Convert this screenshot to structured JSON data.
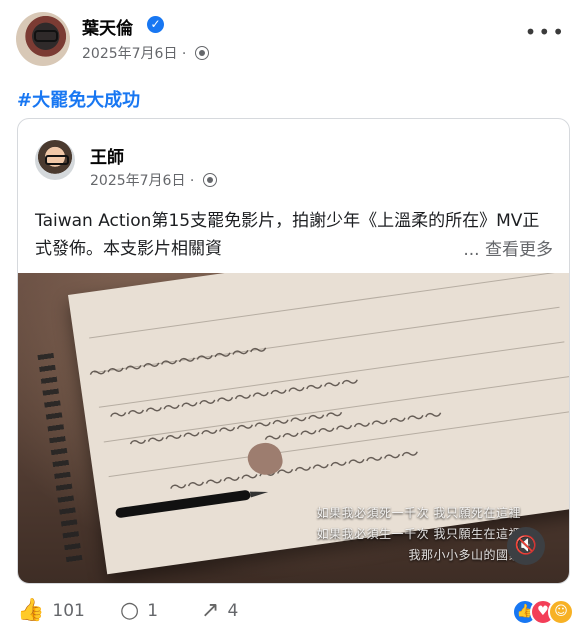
{
  "author": {
    "name": "葉天倫",
    "date": "2025年7月6日",
    "audience_icon": "globe-icon",
    "verified_icon": "verified-badge-icon"
  },
  "hashtag": "#大罷免大成功",
  "shared_post": {
    "author": "王師",
    "date": "2025年7月6日",
    "text": "Taiwan Action第15支罷免影片，拍謝少年《上溫柔的所在》MV正式發佈。本支影片相關資",
    "see_more": "查看更多",
    "ellipsis": "..."
  },
  "video": {
    "subtitles": [
      "如果我必須死一千次 我只願死在這裡",
      "如果我必須生一千次 我只願生在這裡",
      "我那小小多山的國家"
    ],
    "mute_icon": "mute-icon"
  },
  "actions": {
    "likes": "101",
    "comments": "1",
    "shares": "4"
  },
  "colors": {
    "link": "#1877f2",
    "secondary_text": "#65676b"
  }
}
